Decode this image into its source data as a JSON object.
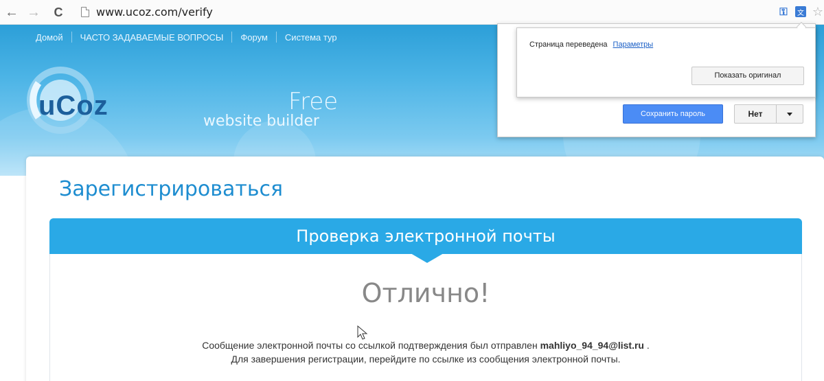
{
  "browser": {
    "url": "www.ucoz.com/verify",
    "back_icon": "←",
    "forward_icon": "→",
    "reload_icon": "C"
  },
  "topnav": {
    "items": [
      "Домой",
      "ЧАСТО ЗАДАВАЕМЫЕ ВОПРОСЫ",
      "Форум",
      "Система тур"
    ]
  },
  "logo": {
    "text": "uCoz",
    "tagline_free": "Free",
    "tagline_builder": "website builder"
  },
  "main": {
    "title": "Зарегистрироваться",
    "panel_title": "Проверка электронной почты",
    "headline": "Отлично!",
    "message_prefix": "Сообщение электронной почты со ссылкой подтверждения был отправлен",
    "email": "mahliyo_94_94@list.ru",
    "message_suffix": ".",
    "message_line2": "Для завершения регистрации, перейдите по ссылке из сообщения электронной почты."
  },
  "translate_popup": {
    "text": "Страница переведена",
    "settings_link": "Параметры",
    "show_original_button": "Показать оригинал"
  },
  "password_popup": {
    "save_button": "Сохранить пароль",
    "no_button": "Нет"
  },
  "colors": {
    "accent": "#2aa9e6",
    "title": "#1e8dd0",
    "save_btn": "#4b8cf5"
  }
}
